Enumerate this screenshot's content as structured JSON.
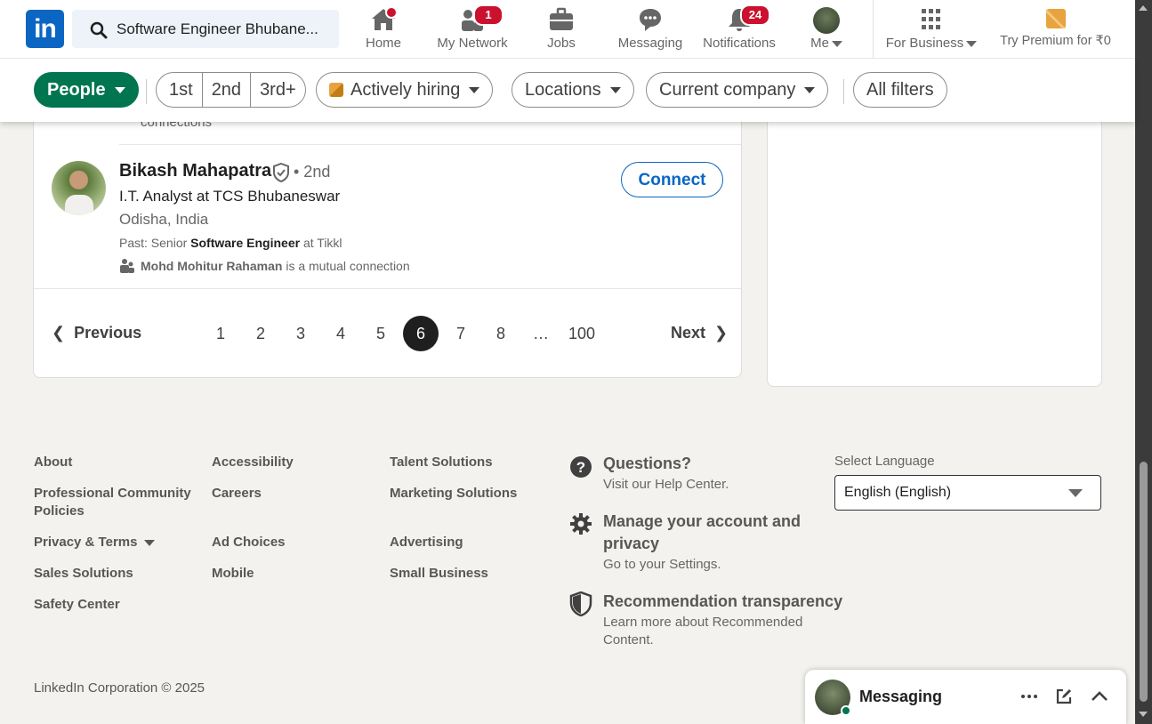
{
  "nav": {
    "search_value": "Software Engineer Bhubane...",
    "items": [
      {
        "label": "Home",
        "badge": ""
      },
      {
        "label": "My Network",
        "badge": "1"
      },
      {
        "label": "Jobs",
        "badge": ""
      },
      {
        "label": "Messaging",
        "badge": ""
      },
      {
        "label": "Notifications",
        "badge": "24"
      },
      {
        "label": "Me",
        "badge": ""
      },
      {
        "label": "For Business",
        "badge": ""
      },
      {
        "label": "Try Premium for ₹0",
        "badge": ""
      }
    ],
    "logo_text": "in"
  },
  "filters": {
    "people": "People",
    "degrees": [
      "1st",
      "2nd",
      "3rd+"
    ],
    "actively_hiring": "Actively hiring",
    "locations": "Locations",
    "current_company": "Current company",
    "all_filters": "All filters"
  },
  "results": {
    "previous_tail": "connections",
    "person": {
      "name": "Bikash Mahapatra",
      "degree": "• 2nd",
      "headline": "I.T. Analyst at TCS Bhubaneswar",
      "location": "Odisha, India",
      "past_prefix": "Past: Senior ",
      "past_role": "Software Engineer",
      "past_suffix": " at Tikkl",
      "mutual_name": "Mohd Mohitur Rahaman",
      "mutual_suffix": " is a mutual connection",
      "connect_label": "Connect"
    }
  },
  "pagination": {
    "previous": "Previous",
    "next": "Next",
    "pages": [
      "1",
      "2",
      "3",
      "4",
      "5",
      "6",
      "7",
      "8",
      "…",
      "100"
    ],
    "current": "6"
  },
  "footer": {
    "col1": [
      "About",
      "Professional Community Policies",
      "Privacy & Terms",
      "Sales Solutions",
      "Safety Center"
    ],
    "col2": [
      "Accessibility",
      "Careers",
      "Ad Choices",
      "Mobile"
    ],
    "col3": [
      "Talent Solutions",
      "Marketing Solutions",
      "Advertising",
      "Small Business"
    ],
    "help": [
      {
        "title": "Questions?",
        "sub": "Visit our Help Center."
      },
      {
        "title": "Manage your account and privacy",
        "sub": "Go to your Settings."
      },
      {
        "title": "Recommendation transparency",
        "sub": "Learn more about Recommended Content."
      }
    ],
    "language_label": "Select Language",
    "language_value": "English (English)",
    "copyright": "LinkedIn Corporation © 2025"
  },
  "messaging": {
    "title": "Messaging"
  },
  "colors": {
    "brand": "#0a66c2",
    "people_pill": "#01754f",
    "badge": "#cb112d"
  }
}
